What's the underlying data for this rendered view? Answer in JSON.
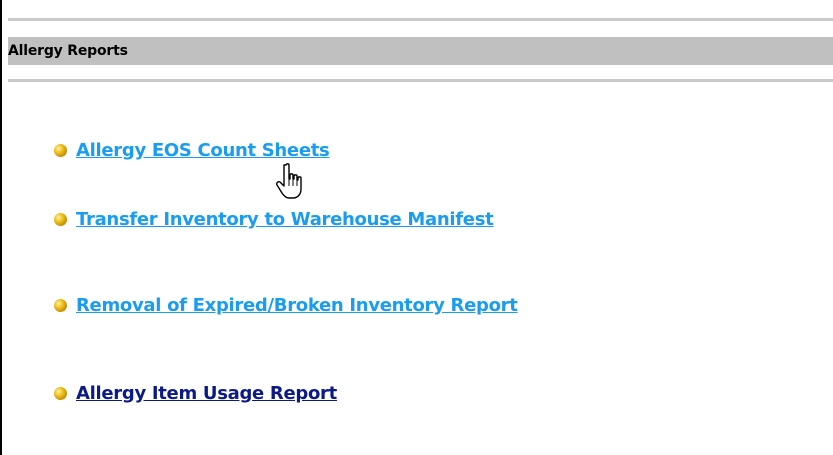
{
  "section": {
    "title": "Allergy Reports"
  },
  "reports": [
    {
      "label": "Allergy EOS Count Sheets",
      "icon": "bullet-icon",
      "visited": false
    },
    {
      "label": "Transfer Inventory to Warehouse Manifest",
      "icon": "bullet-icon",
      "visited": false
    },
    {
      "label": "Removal of Expired/Broken Inventory Report",
      "icon": "bullet-icon",
      "visited": false
    },
    {
      "label": "Allergy Item Usage Report",
      "icon": "bullet-icon",
      "visited": true
    }
  ],
  "colors": {
    "link": "#1a9cf0",
    "visited_link": "#0c1a86",
    "header_bar": "#c0c0c0",
    "rule": "#c9c9c9",
    "bullet": "#e0b020"
  },
  "cursor": {
    "icon": "hand-pointer-icon"
  }
}
